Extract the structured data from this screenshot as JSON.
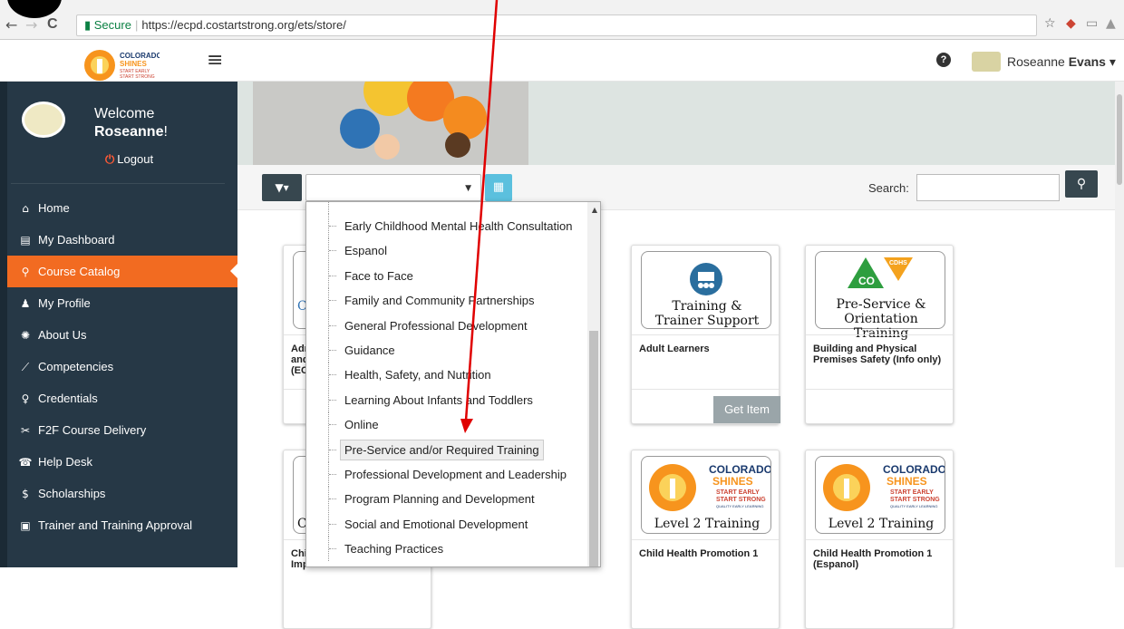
{
  "browser": {
    "secure_label": "Secure",
    "url": "https://ecpd.costartstrong.org/ets/store/",
    "back_icon": "←",
    "forward_icon": "→",
    "reload_icon": "C"
  },
  "header": {
    "logo_line1": "COLORADO",
    "logo_line2": "SHINES",
    "logo_line3": "START EARLY",
    "logo_line4": "START STRONG",
    "help_icon": "?",
    "user_first": "Roseanne",
    "user_last": "Evans",
    "user_caret": "▾"
  },
  "sidebar": {
    "welcome": "Welcome",
    "name": "Roseanne",
    "exclaim": "!",
    "logout": "Logout",
    "items": [
      {
        "label": "Home",
        "icon": "⌂"
      },
      {
        "label": "My Dashboard",
        "icon": "▤"
      },
      {
        "label": "Course Catalog",
        "icon": "⚲"
      },
      {
        "label": "My Profile",
        "icon": "♟"
      },
      {
        "label": "About Us",
        "icon": "✺"
      },
      {
        "label": "Competencies",
        "icon": "⟋"
      },
      {
        "label": "Credentials",
        "icon": "♀"
      },
      {
        "label": "F2F Course Delivery",
        "icon": "✂"
      },
      {
        "label": "Help Desk",
        "icon": "☎"
      },
      {
        "label": "Scholarships",
        "icon": "$"
      },
      {
        "label": "Trainer and Training Approval",
        "icon": "▣"
      }
    ],
    "active_index": 2
  },
  "toolbar": {
    "filter_label": "▼▾",
    "calendar_icon": "▦",
    "search_label": "Search:",
    "search_value": "",
    "search_icon": "⚲"
  },
  "dropdown": {
    "items": [
      "Early Childhood Mental Health Consultation",
      "Espanol",
      "Face to Face",
      "Family and Community Partnerships",
      "General Professional Development",
      "Guidance",
      "Health, Safety, and Nutrition",
      "Learning About Infants and Toddlers",
      "Online",
      "Pre-Service and/or Required Training",
      "Professional Development and Leadership",
      "Program Planning and Development",
      "Social and Emotional Development",
      "Teaching Practices"
    ],
    "highlighted_index": 9
  },
  "cards": [
    {
      "title": "Adr and (EC",
      "image_text": "C"
    },
    {
      "title": "Adult Learners",
      "image_line1": "Training &",
      "image_line2": "Trainer Support",
      "button": "Get Item"
    },
    {
      "title": "Building and Physical Premises Safety (Info only)",
      "image_line1": "Pre-Service &",
      "image_line2": "Orientation Training",
      "badge_top": "CDHS",
      "badge_co": "CO"
    },
    {
      "title": "Chi Imp",
      "image_text": "C"
    },
    {
      "title": "Child Health Promotion 1",
      "image_line2": "Level 2 Training",
      "logo_line1": "COLORADO",
      "logo_line2": "SHINES",
      "logo_line3": "START EARLY",
      "logo_line4": "START STRONG",
      "logo_line5": "QUALITY EARLY LEARNING"
    },
    {
      "title": "Child Health Promotion 1 (Espanol)",
      "image_line2": "Level 2 Training",
      "logo_line1": "COLORADO",
      "logo_line2": "SHINES",
      "logo_line3": "START EARLY",
      "logo_line4": "START STRONG",
      "logo_line5": "QUALITY EARLY LEARNING"
    }
  ],
  "colors": {
    "sidebar_bg": "#263846",
    "active_orange": "#f26b21",
    "dark_button": "#37474f",
    "calendar_blue": "#5bc0de",
    "arrow_red": "#e00000"
  }
}
